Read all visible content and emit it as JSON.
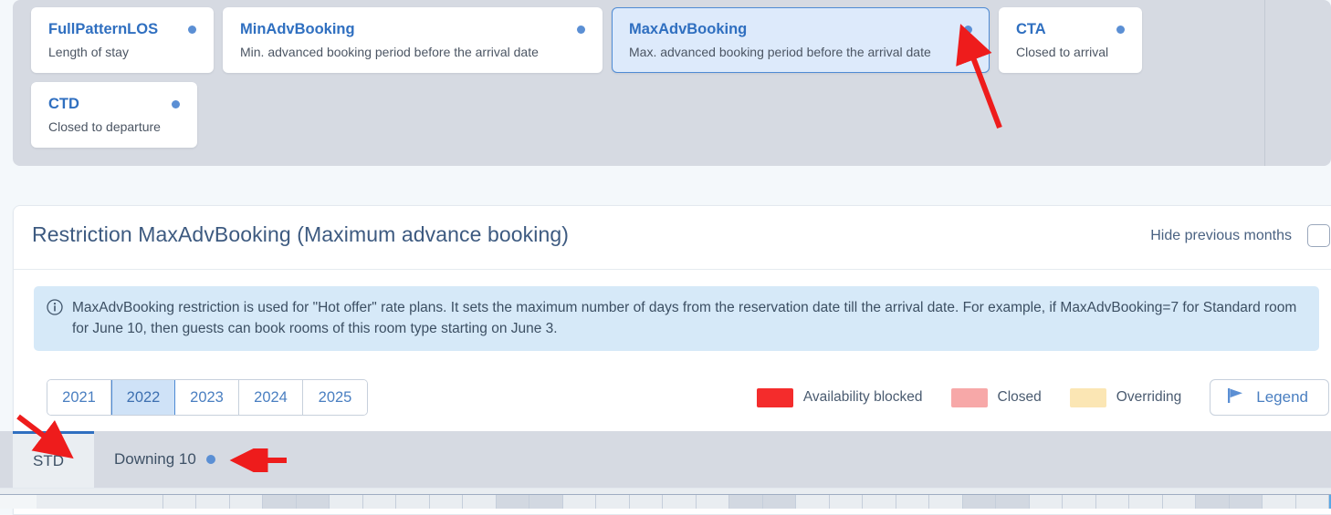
{
  "restriction_cards": [
    {
      "title": "FullPatternLOS",
      "subtitle": "Length of stay",
      "selected": false,
      "width_class": "w-fullpattern"
    },
    {
      "title": "MinAdvBooking",
      "subtitle": "Min. advanced booking period before the arrival date",
      "selected": false,
      "width_class": "w-minadv"
    },
    {
      "title": "MaxAdvBooking",
      "subtitle": "Max. advanced booking period before the arrival date",
      "selected": true,
      "width_class": "w-maxadv"
    },
    {
      "title": "CTA",
      "subtitle": "Closed to arrival",
      "selected": false,
      "width_class": "w-cta"
    },
    {
      "title": "CTD",
      "subtitle": "Closed to departure",
      "selected": false,
      "width_class": "w-ctd"
    }
  ],
  "main": {
    "title": "Restriction MaxAdvBooking (Maximum advance booking)",
    "hide_previous_months_label": "Hide previous months",
    "hide_previous_months_checked": false,
    "info_banner": "MaxAdvBooking restriction is used for \"Hot offer\" rate plans. It sets the maximum number of days from the reservation date till the arrival date. For example, if MaxAdvBooking=7 for Standard room for June 10, then guests can book rooms of this room type starting on June 3."
  },
  "years": {
    "options": [
      "2021",
      "2022",
      "2023",
      "2024",
      "2025"
    ],
    "selected": "2022"
  },
  "legend": {
    "items": [
      {
        "label": "Availability blocked",
        "color": "#f42c2c"
      },
      {
        "label": "Closed",
        "color": "#f7a8a8"
      },
      {
        "label": "Overriding",
        "color": "#fbe6b4"
      }
    ],
    "button_label": "Legend"
  },
  "room_tabs": [
    {
      "label": "STD",
      "active": true
    },
    {
      "label": "Downing 10",
      "active": false
    }
  ],
  "colors": {
    "accent_blue": "#2f6fc0",
    "panel_gray": "#d6dae2",
    "info_blue": "#d6e9f8",
    "selected_card": "#ddeafb",
    "annotation_red": "#ee1c1c"
  }
}
